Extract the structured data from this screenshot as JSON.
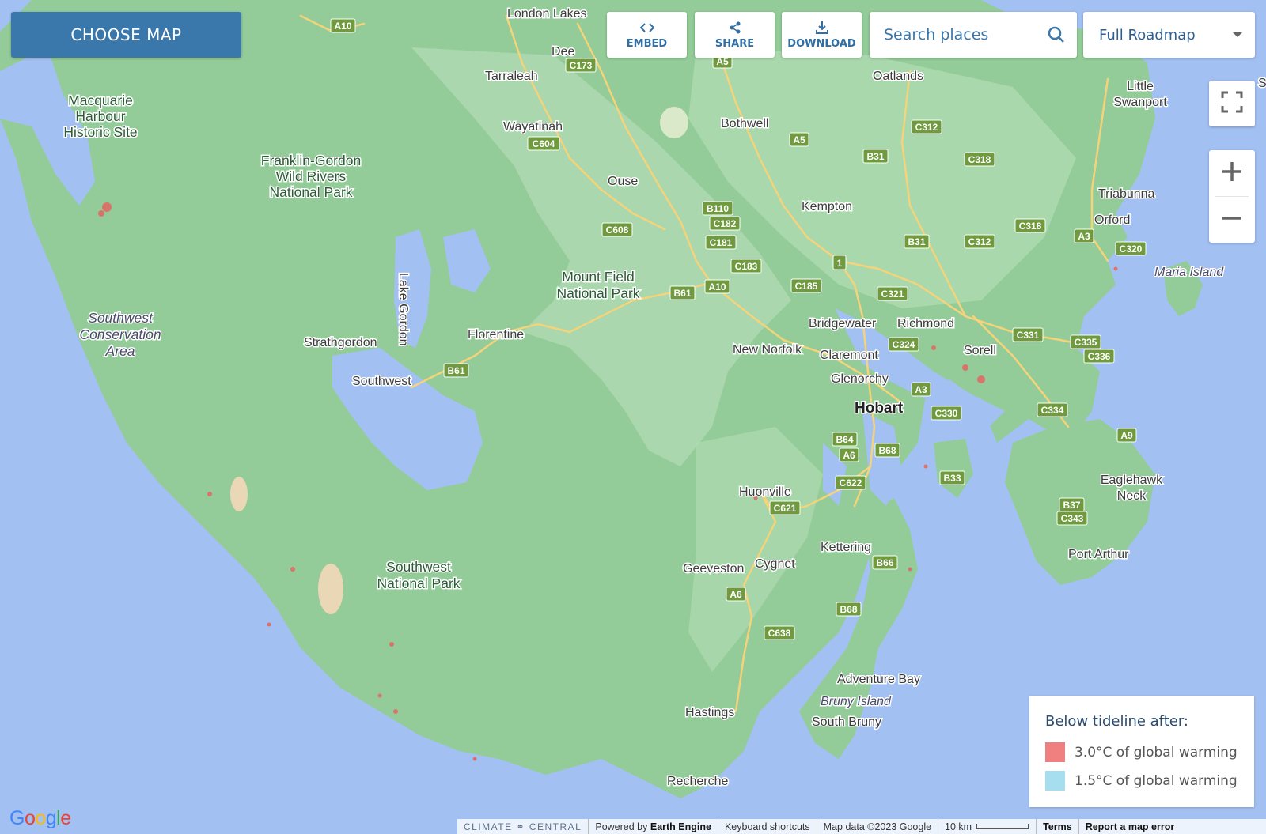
{
  "toolbar": {
    "choose_map": "CHOOSE MAP",
    "embed": "EMBED",
    "share": "SHARE",
    "download": "DOWNLOAD",
    "search_placeholder": "Search places",
    "map_type": "Full Roadmap"
  },
  "legend": {
    "title": "Below tideline after:",
    "items": [
      {
        "label": "3.0°C of global warming",
        "color": "#f08080"
      },
      {
        "label": "1.5°C of global warming",
        "color": "#a6def0"
      }
    ]
  },
  "attribution": {
    "brand": "CLIMATE ⚭ CENTRAL",
    "powered_prefix": "Powered by ",
    "powered_name": "Earth Engine",
    "shortcuts": "Keyboard shortcuts",
    "map_data": "Map data ©2023 Google",
    "scale": "10 km",
    "terms": "Terms",
    "report": "Report a map error"
  },
  "logo": {
    "letters": [
      "G",
      "o",
      "o",
      "g",
      "l",
      "e"
    ]
  },
  "colors": {
    "water": "#a3c0f3",
    "land": "#93cc98",
    "land_light": "#b7deb9",
    "accent": "#3a77ab"
  },
  "map": {
    "places": {
      "macquarie_1": "Macquarie",
      "macquarie_2": "Harbour",
      "macquarie_3": "Historic Site",
      "franklin_1": "Franklin-Gordon",
      "franklin_2": "Wild Rivers",
      "franklin_3": "National Park",
      "sw_cons_1": "Southwest",
      "sw_cons_2": "Conservation",
      "sw_cons_3": "Area",
      "strathgordon": "Strathgordon",
      "southwest": "Southwest",
      "lake_gordon": "Lake Gordon",
      "florentine": "Florentine",
      "mount_field_1": "Mount Field",
      "mount_field_2": "National Park",
      "sw_np_1": "Southwest",
      "sw_np_2": "National Park",
      "london_lakes": "London Lakes",
      "dee": "Dee",
      "tarraleah": "Tarraleah",
      "wayatinah": "Wayatinah",
      "ouse": "Ouse",
      "bothwell": "Bothwell",
      "oatlands": "Oatlands",
      "kempton": "Kempton",
      "little_swanport_1": "Little",
      "little_swanport_2": "Swanport",
      "triabunna": "Triabunna",
      "orford": "Orford",
      "maria_island": "Maria Island",
      "bridgewater": "Bridgewater",
      "richmond": "Richmond",
      "new_norfolk": "New Norfolk",
      "claremont": "Claremont",
      "sorell": "Sorell",
      "glenorchy": "Glenorchy",
      "hobart": "Hobart",
      "huonville": "Huonville",
      "kettering": "Kettering",
      "geeveston": "Geeveston",
      "cygnet": "Cygnet",
      "adventure_bay": "Adventure Bay",
      "bruny_island": "Bruny Island",
      "south_bruny": "South Bruny",
      "hastings": "Hastings",
      "recherche": "Recherche",
      "eaglehawk_1": "Eaglehawk",
      "eaglehawk_2": "Neck",
      "port_arthur": "Port Arthur",
      "port_arthur_edge": "S"
    },
    "shields": {
      "a10_top": "A10",
      "c173": "C173",
      "a5_top": "A5",
      "c604": "C604",
      "a5": "A5",
      "c312_top": "C312",
      "b31_top": "B31",
      "c318_top": "C318",
      "b110": "B110",
      "c182": "C182",
      "c608": "C608",
      "c181": "C181",
      "b31": "B31",
      "c312": "C312",
      "c318": "C318",
      "a3_e": "A3",
      "c320": "C320",
      "one": "1",
      "c183": "C183",
      "a10": "A10",
      "c185": "C185",
      "b61_e": "B61",
      "c321": "C321",
      "c324": "C324",
      "c331": "C331",
      "c335": "C335",
      "c336": "C336",
      "b61_w": "B61",
      "a3": "A3",
      "c330": "C330",
      "c334": "C334",
      "b64": "B64",
      "b68_n": "B68",
      "a6_n": "A6",
      "a9": "A9",
      "c622": "C622",
      "b33": "B33",
      "c621": "C621",
      "b37": "B37",
      "c343": "C343",
      "b66": "B66",
      "a6": "A6",
      "b68": "B68",
      "c638": "C638"
    }
  }
}
